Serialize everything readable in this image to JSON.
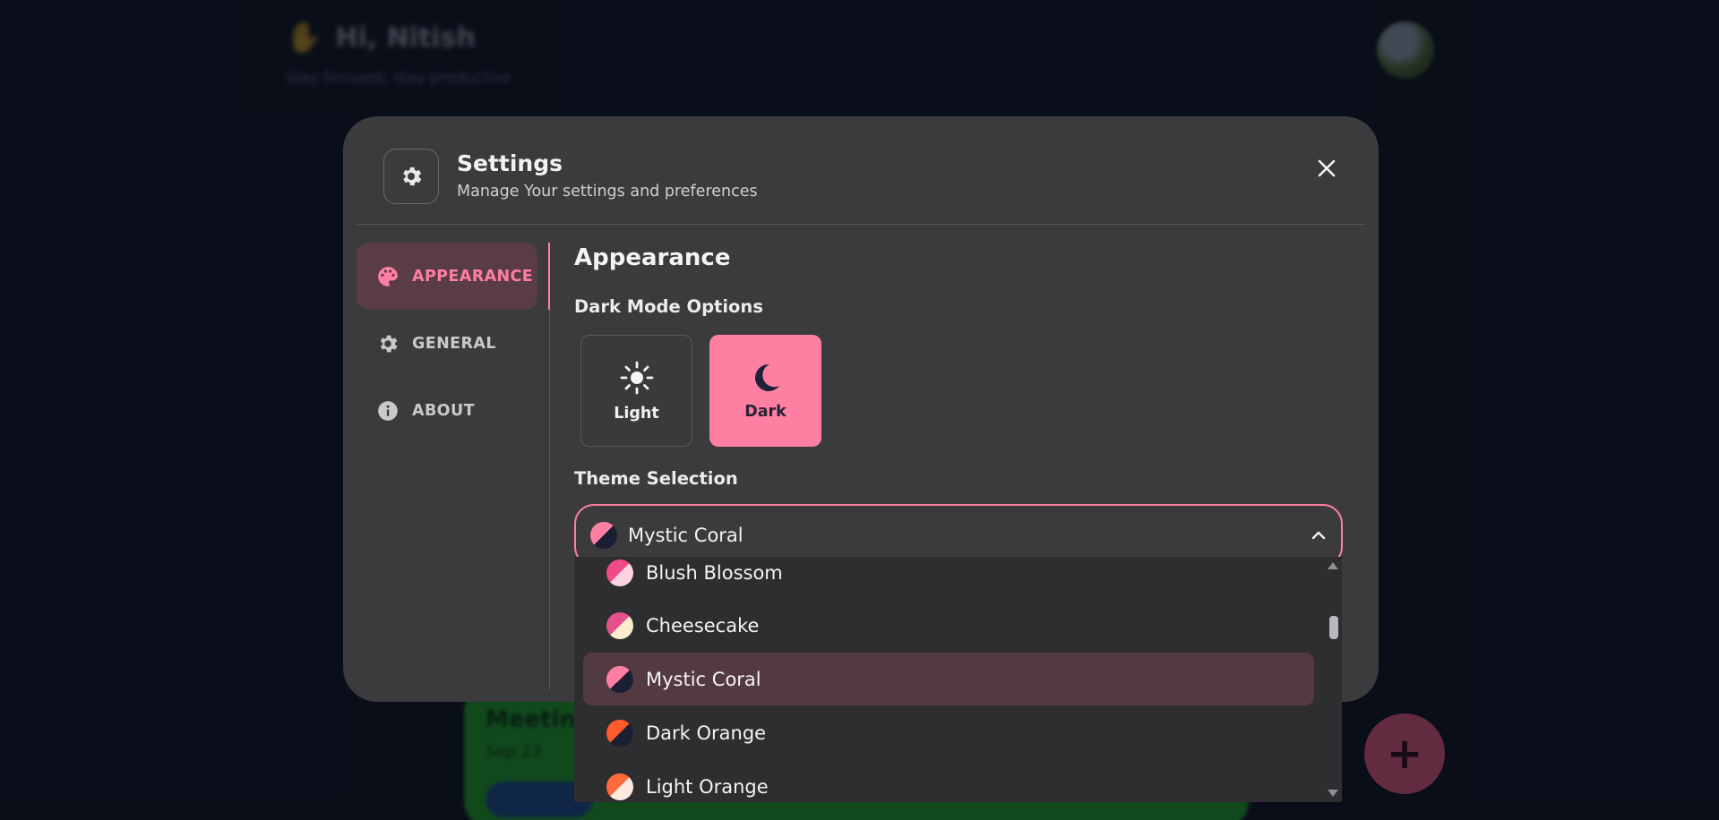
{
  "background": {
    "greeting_icon": "wave-hand-icon",
    "greeting": "Hi, Nitish",
    "subtitle": "Stay focused, stay productive",
    "task_title": "Meeting",
    "task_detail": "Sep 23",
    "fab_label": "+"
  },
  "settings": {
    "title": "Settings",
    "subtitle": "Manage Your settings and preferences",
    "header_icon": "gear-icon",
    "close_icon": "close-icon"
  },
  "sidebar": {
    "items": [
      {
        "label": "APPEARANCE",
        "icon": "palette-icon",
        "active": true
      },
      {
        "label": "GENERAL",
        "icon": "gear-icon",
        "active": false
      },
      {
        "label": "ABOUT",
        "icon": "info-icon",
        "active": false
      }
    ]
  },
  "appearance": {
    "title": "Appearance",
    "dark_mode_label": "Dark Mode Options",
    "modes": [
      {
        "label": "Light",
        "icon": "sun-icon",
        "selected": false
      },
      {
        "label": "Dark",
        "icon": "moon-icon",
        "selected": true
      }
    ],
    "theme_label": "Theme Selection",
    "selected_theme": "Mystic Coral"
  },
  "themes": [
    {
      "name": "Blush Blossom",
      "primary": "#ef4b86",
      "secondary": "#fdd5e2"
    },
    {
      "name": "Cheesecake",
      "primary": "#e4508c",
      "secondary": "#fbeccb"
    },
    {
      "name": "Mystic Coral",
      "primary": "#ff7fa3",
      "secondary": "#1b1f33",
      "selected": true
    },
    {
      "name": "Dark Orange",
      "primary": "#ff5a2c",
      "secondary": "#1b1f33"
    },
    {
      "name": "Light Orange",
      "primary": "#ff6a3d",
      "secondary": "#fde9e0"
    }
  ],
  "colors": {
    "accent": "#ff7fa3",
    "modal_bg": "#3b3b3d",
    "page_bg": "#0d1322"
  }
}
